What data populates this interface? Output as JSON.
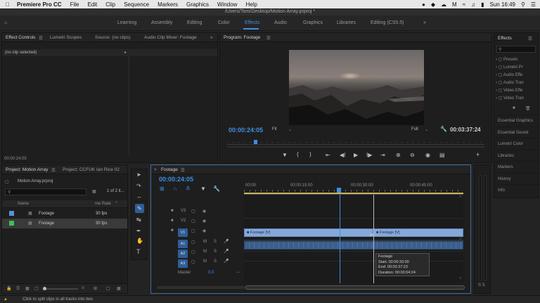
{
  "menubar": {
    "app": "Premiere Pro CC",
    "items": [
      "File",
      "Edit",
      "Clip",
      "Sequence",
      "Markers",
      "Graphics",
      "Window",
      "Help"
    ],
    "clock": "Sun 16:49"
  },
  "window_title": "/Users/Tom/Desktop/Motion Array.prproj *",
  "workspaces": [
    "Learning",
    "Assembly",
    "Editing",
    "Color",
    "Effects",
    "Audio",
    "Graphics",
    "Libraries",
    "Editing (CS5.5)"
  ],
  "workspace_active": "Effects",
  "effect_controls": {
    "tabs": [
      "Effect Controls",
      "Lumetri Scopes",
      "Source: (no clips)",
      "Audio Clip Mixer: Footage"
    ],
    "empty_label": "(no clip selected)",
    "timecode": "00:00:24:05"
  },
  "program": {
    "title": "Program: Footage",
    "timecode": "00:00:24:05",
    "fit": "Fit",
    "quality": "Full",
    "duration": "00:03:37:24"
  },
  "effects_panel": {
    "title": "Effects",
    "search_placeholder": "",
    "folders": [
      "Presets",
      "Lumetri Pr",
      "Audio Effe",
      "Audio Tran",
      "Video Effe",
      "Video Tran"
    ],
    "side_items": [
      "Essential Graphics",
      "Essential Sound",
      "Lumetri Color",
      "Libraries",
      "Markers",
      "History",
      "Info"
    ]
  },
  "project": {
    "tabs": [
      "Project: Motion Array",
      "Project: CCFUK Ian Rice 02"
    ],
    "file": "Motion Array.prproj",
    "count": "1 of 2 it...",
    "columns": [
      "Name",
      "me Rate"
    ],
    "items": [
      {
        "name": "Footage",
        "rate": "30 fps",
        "color": "#5a8fd8"
      },
      {
        "name": "Footage",
        "rate": "30 fps",
        "color": "#3fbf5a"
      }
    ]
  },
  "timeline": {
    "tab": "Footage",
    "timecode": "00:00:24:05",
    "ruler": [
      "00:00",
      "00:00:15:00",
      "00:00:30:00",
      "00:00:45:00"
    ],
    "video_tracks": [
      "V3",
      "V2",
      "V1"
    ],
    "audio_tracks": [
      "A1",
      "A2",
      "A3"
    ],
    "master": "Master",
    "master_val": "0.0",
    "clip_label": "Footage [V]",
    "tooltip": {
      "title": "Footage",
      "start": "Start: 00:00:33:00",
      "end": "End: 00:03:37:23",
      "duration": "Duration: 00:03:04:24"
    }
  },
  "meter": {
    "label": "S S"
  },
  "status": "Click to split clips in all tracks into two."
}
